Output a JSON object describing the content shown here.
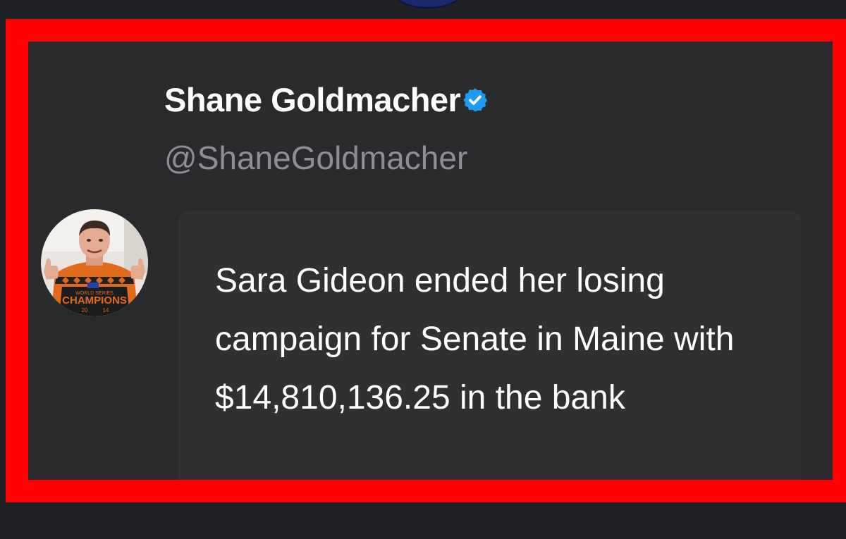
{
  "tweet": {
    "display_name": "Shane Goldmacher",
    "handle": "@ShaneGoldmacher",
    "verified": true,
    "text": "Sara Gideon ended her losing campaign for Senate in Maine with $14,810,136.25 in the bank",
    "avatar": {
      "shirt_lines": [
        "WORLD SERIES",
        "CHAMPIONS",
        "20",
        "14"
      ]
    }
  },
  "colors": {
    "highlight": "#ff0000",
    "verified_badge": "#1d9bf0",
    "background": "#202125",
    "bubble": "#303033"
  }
}
